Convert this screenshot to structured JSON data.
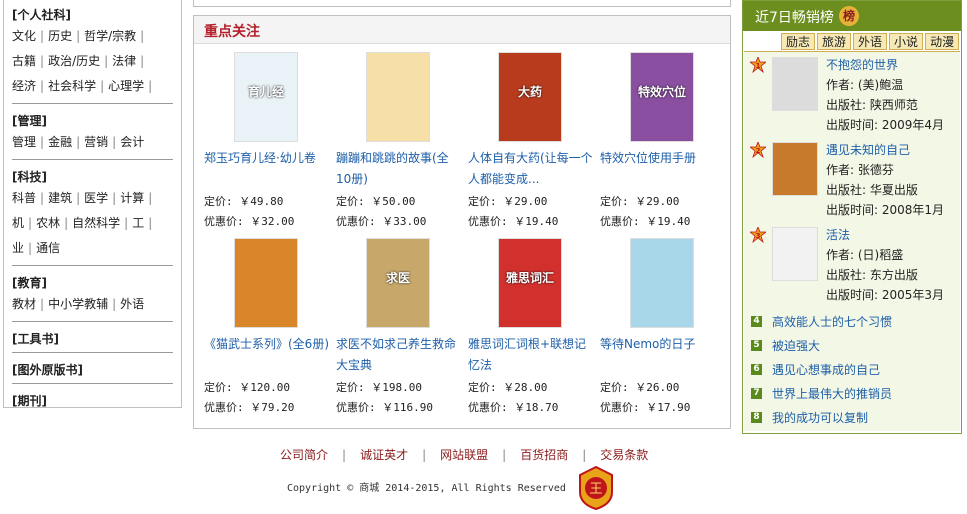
{
  "categories": [
    {
      "title": "[个人社科]",
      "lines": [
        [
          "文化",
          "历史",
          "哲学/宗教"
        ],
        [
          "古籍",
          "政治/历史",
          "法律"
        ],
        [
          "经济",
          "社会科学",
          "心理学"
        ]
      ]
    },
    {
      "title": "[管理]",
      "lines": [
        [
          "管理",
          "金融",
          "营销",
          "会计"
        ]
      ]
    },
    {
      "title": "[科技]",
      "lines": [
        [
          "科普",
          "建筑",
          "医学",
          "计算"
        ],
        [
          "机",
          "农林",
          "自然科学",
          "工"
        ],
        [
          "业",
          "通信"
        ]
      ]
    },
    {
      "title": "[教育]",
      "lines": [
        [
          "教材",
          "中小学教辅",
          "外语"
        ]
      ]
    },
    {
      "title": "[工具书]",
      "lines": []
    },
    {
      "title": "[图外原版书]",
      "lines": []
    },
    {
      "title": "[期刊]",
      "lines": []
    }
  ],
  "main": {
    "heading": "重点关注",
    "products": [
      {
        "name": "郑玉巧育儿经·幼儿卷",
        "price": "定价: ￥49.80",
        "discount": "优惠价: ￥32.00",
        "cover": "#e8f2f7",
        "cover_text": "育儿经"
      },
      {
        "name": "蹦蹦和跳跳的故事(全10册)",
        "price": "定价: ￥50.00",
        "discount": "优惠价: ￥33.00",
        "cover": "#f6e0a8",
        "cover_text": ""
      },
      {
        "name": "人体自有大药(让每一个人都能变成...",
        "price": "定价: ￥29.00",
        "discount": "优惠价: ￥19.40",
        "cover": "#b83b1e",
        "cover_text": "大药"
      },
      {
        "name": "特效穴位使用手册",
        "price": "定价: ￥29.00",
        "discount": "优惠价: ￥19.40",
        "cover": "#8a4fa0",
        "cover_text": "特效穴位"
      },
      {
        "name": "《猫武士系列》(全6册)",
        "price": "定价: ￥120.00",
        "discount": "优惠价: ￥79.20",
        "cover": "#d9862a",
        "cover_text": ""
      },
      {
        "name": "求医不如求己养生救命大宝典",
        "price": "定价: ￥198.00",
        "discount": "优惠价: ￥116.90",
        "cover": "#c8a86a",
        "cover_text": "求医"
      },
      {
        "name": "雅思词汇词根+联想记忆法",
        "price": "定价: ￥28.00",
        "discount": "优惠价: ￥18.70",
        "cover": "#d2302c",
        "cover_text": "雅思词汇"
      },
      {
        "name": "等待Nemo的日子",
        "price": "定价: ￥26.00",
        "discount": "优惠价: ￥17.90",
        "cover": "#a8d7ea",
        "cover_text": ""
      }
    ]
  },
  "ranking": {
    "title": "近7日畅销榜",
    "badge": "榜",
    "tabs": [
      "励志",
      "旅游",
      "外语",
      "小说",
      "动漫"
    ],
    "top3": [
      {
        "rank": "1",
        "title": "不抱怨的世界",
        "author": "作者: (美)鲍温",
        "publisher": "出版社: 陕西师范",
        "date": "出版时间: 2009年4月",
        "thumb": "#dcdcdc"
      },
      {
        "rank": "2",
        "title": "遇见未知的自己",
        "author": "作者: 张德芬",
        "publisher": "出版社: 华夏出版",
        "date": "出版时间: 2008年1月",
        "thumb": "#c77a2c"
      },
      {
        "rank": "3",
        "title": "活法",
        "author": "作者: (日)稻盛",
        "publisher": "出版社: 东方出版",
        "date": "出版时间: 2005年3月",
        "thumb": "#f2f2f2"
      }
    ],
    "items": [
      {
        "rank": "4",
        "title": "高效能人士的七个习惯"
      },
      {
        "rank": "5",
        "title": "被迫强大"
      },
      {
        "rank": "6",
        "title": "遇见心想事成的自己"
      },
      {
        "rank": "7",
        "title": "世界上最伟大的推销员"
      },
      {
        "rank": "8",
        "title": "我的成功可以复制"
      }
    ]
  },
  "footer": {
    "links": [
      "公司简介",
      "诚证英才",
      "网站联盟",
      "百货招商",
      "交易条款"
    ],
    "copyright": "Copyright © 商城 2014-2015, All Rights Reserved",
    "logo_text": "王"
  }
}
